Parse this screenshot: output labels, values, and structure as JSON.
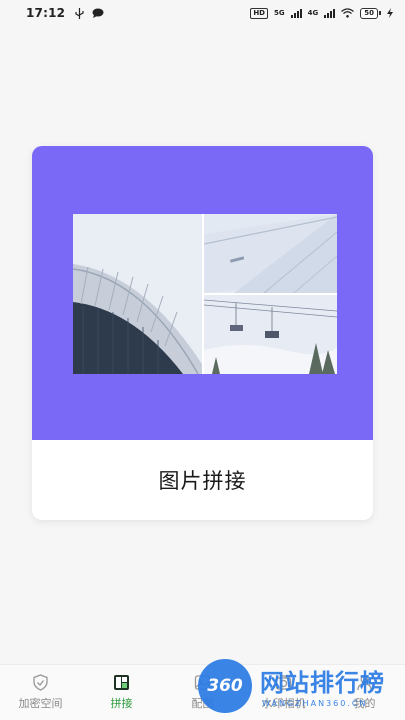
{
  "status": {
    "time": "17:12",
    "hd": "HD",
    "net1": "5G",
    "net2": "4G",
    "battery": "50",
    "usb_icon": "usb-icon",
    "msg_icon": "chat-bubble-icon",
    "wifi_icon": "wifi-icon",
    "charge_icon": "charging-icon"
  },
  "card": {
    "title": "图片拼接",
    "accent_color": "#7a68f6"
  },
  "nav": {
    "items": [
      {
        "label": "加密空间",
        "icon": "shield-icon"
      },
      {
        "label": "拼接",
        "icon": "collage-icon",
        "active": true
      },
      {
        "label": "配图",
        "icon": "image-icon"
      },
      {
        "label": "水印相机",
        "icon": "camera-icon"
      },
      {
        "label": "我的",
        "icon": "user-icon"
      }
    ],
    "active_color": "#2f9b3d"
  },
  "watermark": {
    "badge": "360",
    "title": "网站排行榜",
    "sub": "WANGZHAN360.CN"
  }
}
